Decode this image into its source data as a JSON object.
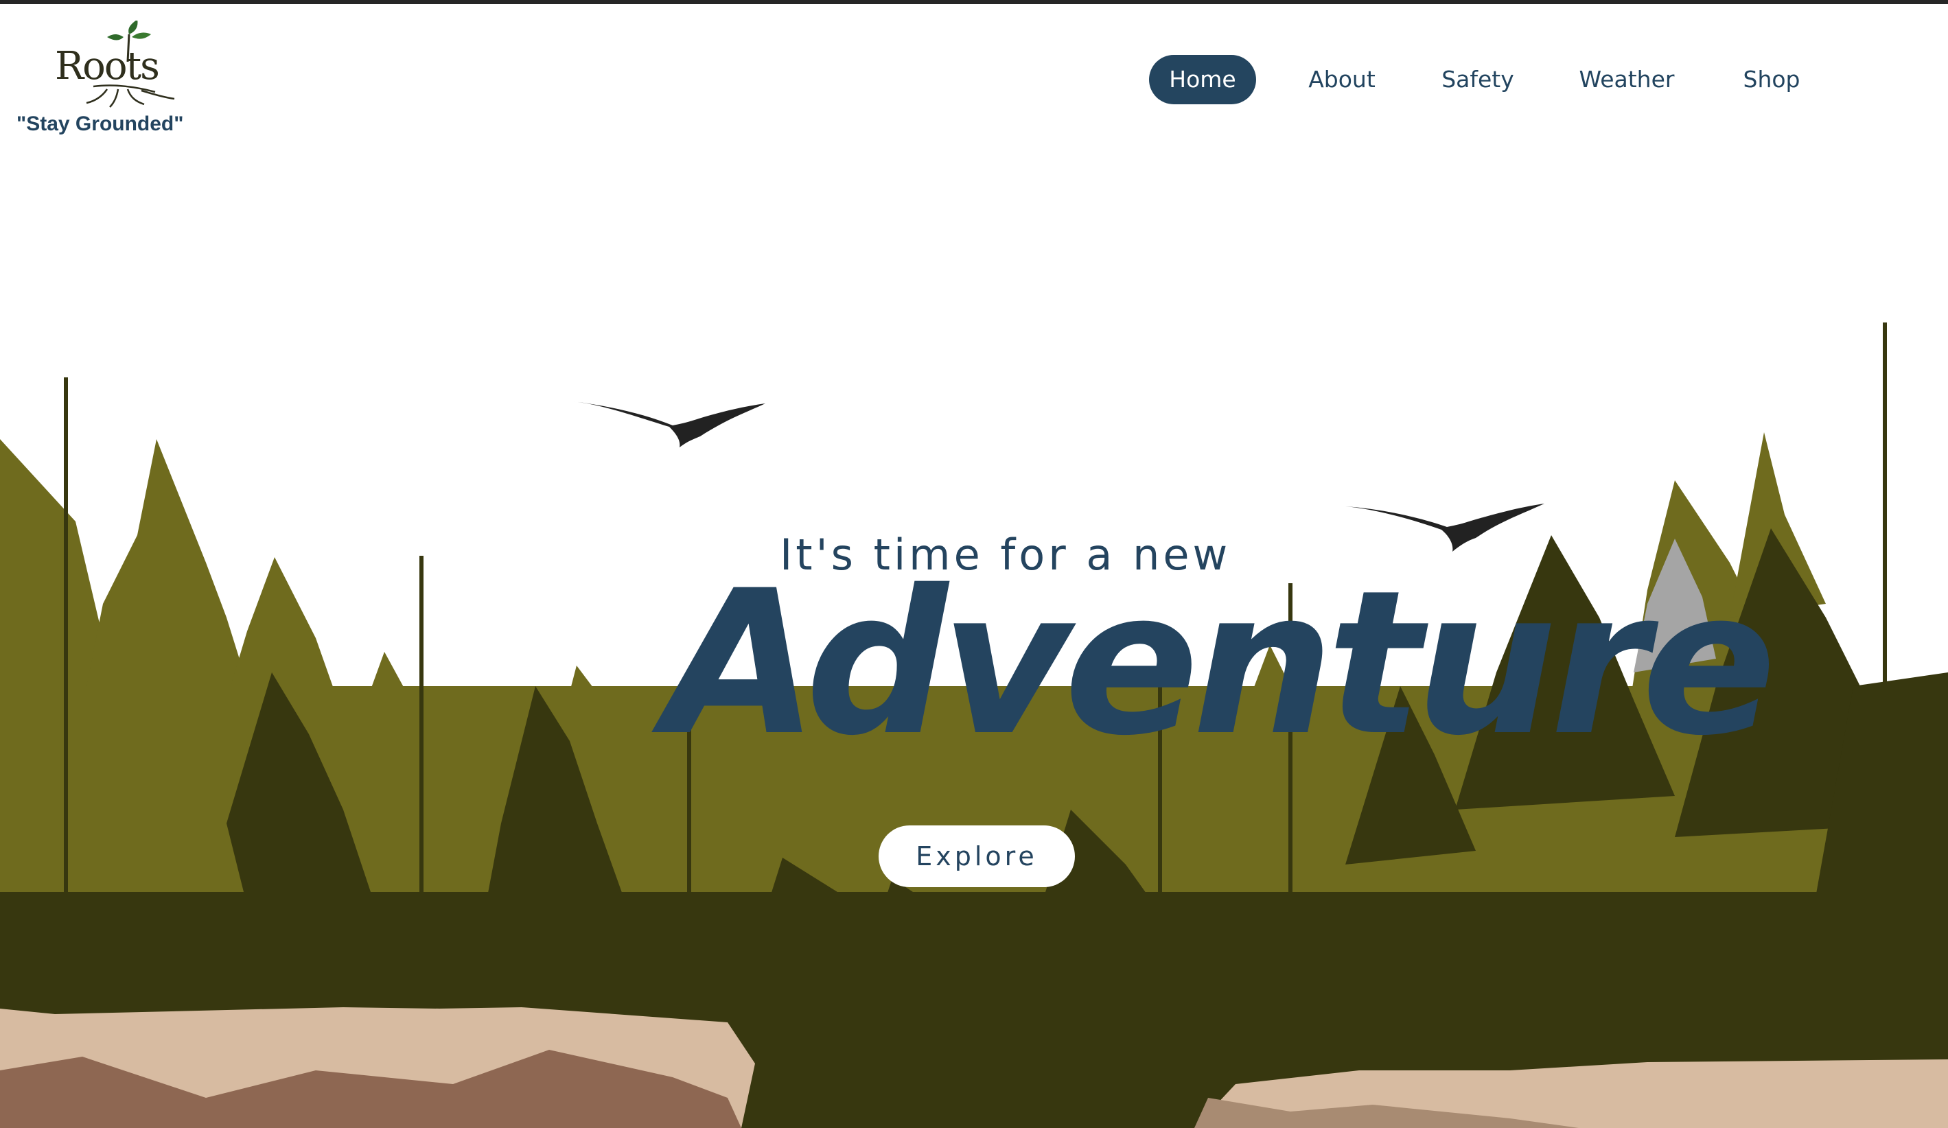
{
  "brand": {
    "logo_text": "Roots",
    "tagline": "\"Stay Grounded\""
  },
  "nav": {
    "items": [
      "Home",
      "About",
      "Safety",
      "Weather",
      "Shop"
    ],
    "active": "Home"
  },
  "hero": {
    "subtitle": "It's time for a new",
    "headline": "Adventure",
    "button_label": "Explore"
  },
  "colors": {
    "primary": "#24455f",
    "forest_light": "#6f6b1e",
    "forest_dark": "#37370f",
    "cliff": "#d7bba1"
  },
  "icons": [
    "bird-icon",
    "leaf-icon"
  ]
}
